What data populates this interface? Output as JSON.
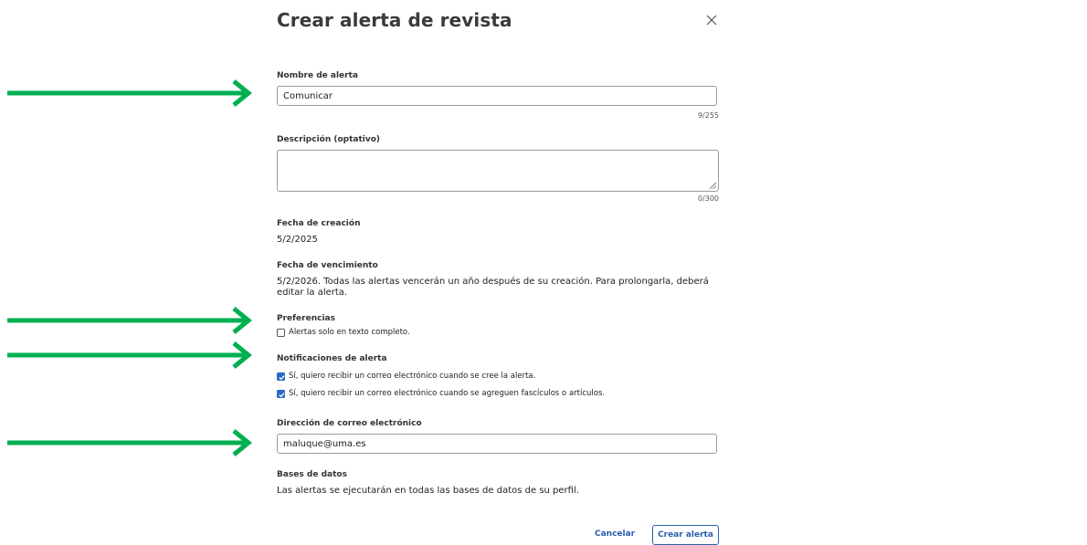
{
  "dialog": {
    "title": "Crear alerta de revista",
    "close_icon": "close-icon",
    "alert_name": {
      "label": "Nombre de alerta",
      "value": "Comunicar",
      "counter": "9/255"
    },
    "description": {
      "label": "Descripción (optativo)",
      "value": "",
      "counter": "0/300"
    },
    "creation_date": {
      "label": "Fecha de creación",
      "value": "5/2/2025"
    },
    "expiry_date": {
      "label": "Fecha de vencimiento",
      "value": "5/2/2026. Todas las alertas vencerán un año después de su creación. Para prolongarla, deberá editar la alerta."
    },
    "preferences": {
      "label": "Preferencias",
      "options": [
        {
          "label": "Alertas solo en texto completo.",
          "checked": false
        }
      ]
    },
    "notifications": {
      "label": "Notificaciones de alerta",
      "options": [
        {
          "label": "Sí, quiero recibir un correo electrónico cuando se cree la alerta.",
          "checked": true
        },
        {
          "label": "Sí, quiero recibir un correo electrónico cuando se agreguen fascículos o artículos.",
          "checked": true
        }
      ]
    },
    "email": {
      "label": "Dirección de correo electrónico",
      "value": "maluque@uma.es"
    },
    "databases": {
      "label": "Bases de datos",
      "value": "Las alertas se ejecutarán en todas las bases de datos de su perfil."
    },
    "buttons": {
      "cancel": "Cancelar",
      "create": "Crear alerta"
    }
  },
  "annotations": {
    "arrow_color": "#00b050",
    "arrow_icon": "right-arrow-icon"
  }
}
